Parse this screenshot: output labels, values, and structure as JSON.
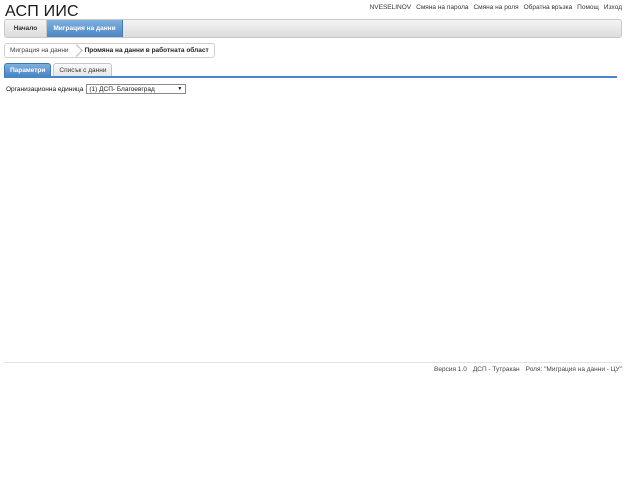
{
  "app": {
    "title": "АСП ИИС"
  },
  "top_links": {
    "user": "NVESELINOV",
    "change_password": "Смяна на парола",
    "change_role": "Смяна на роля",
    "feedback": "Обратна връзка",
    "help": "Помощ",
    "logout": "Изход"
  },
  "nav": {
    "home": "Начало",
    "migration": "Миграция на данни"
  },
  "breadcrumb": {
    "first": "Миграция на данни",
    "current": "Промяна на данни в работната област"
  },
  "tabs": {
    "parameters": "Параметри",
    "data_list": "Списък с данни"
  },
  "form": {
    "org_unit_label": "Организационна единица",
    "org_unit_value": "(1) ДСП- Благоевград"
  },
  "footer": {
    "version": "Версия 1.0",
    "office": "ДСП - Тутракан",
    "role": "Роля: \"Миграция на данни - ЦУ\""
  },
  "colors": {
    "accent": "#4a86c5",
    "accent_light": "#7fb0de"
  }
}
